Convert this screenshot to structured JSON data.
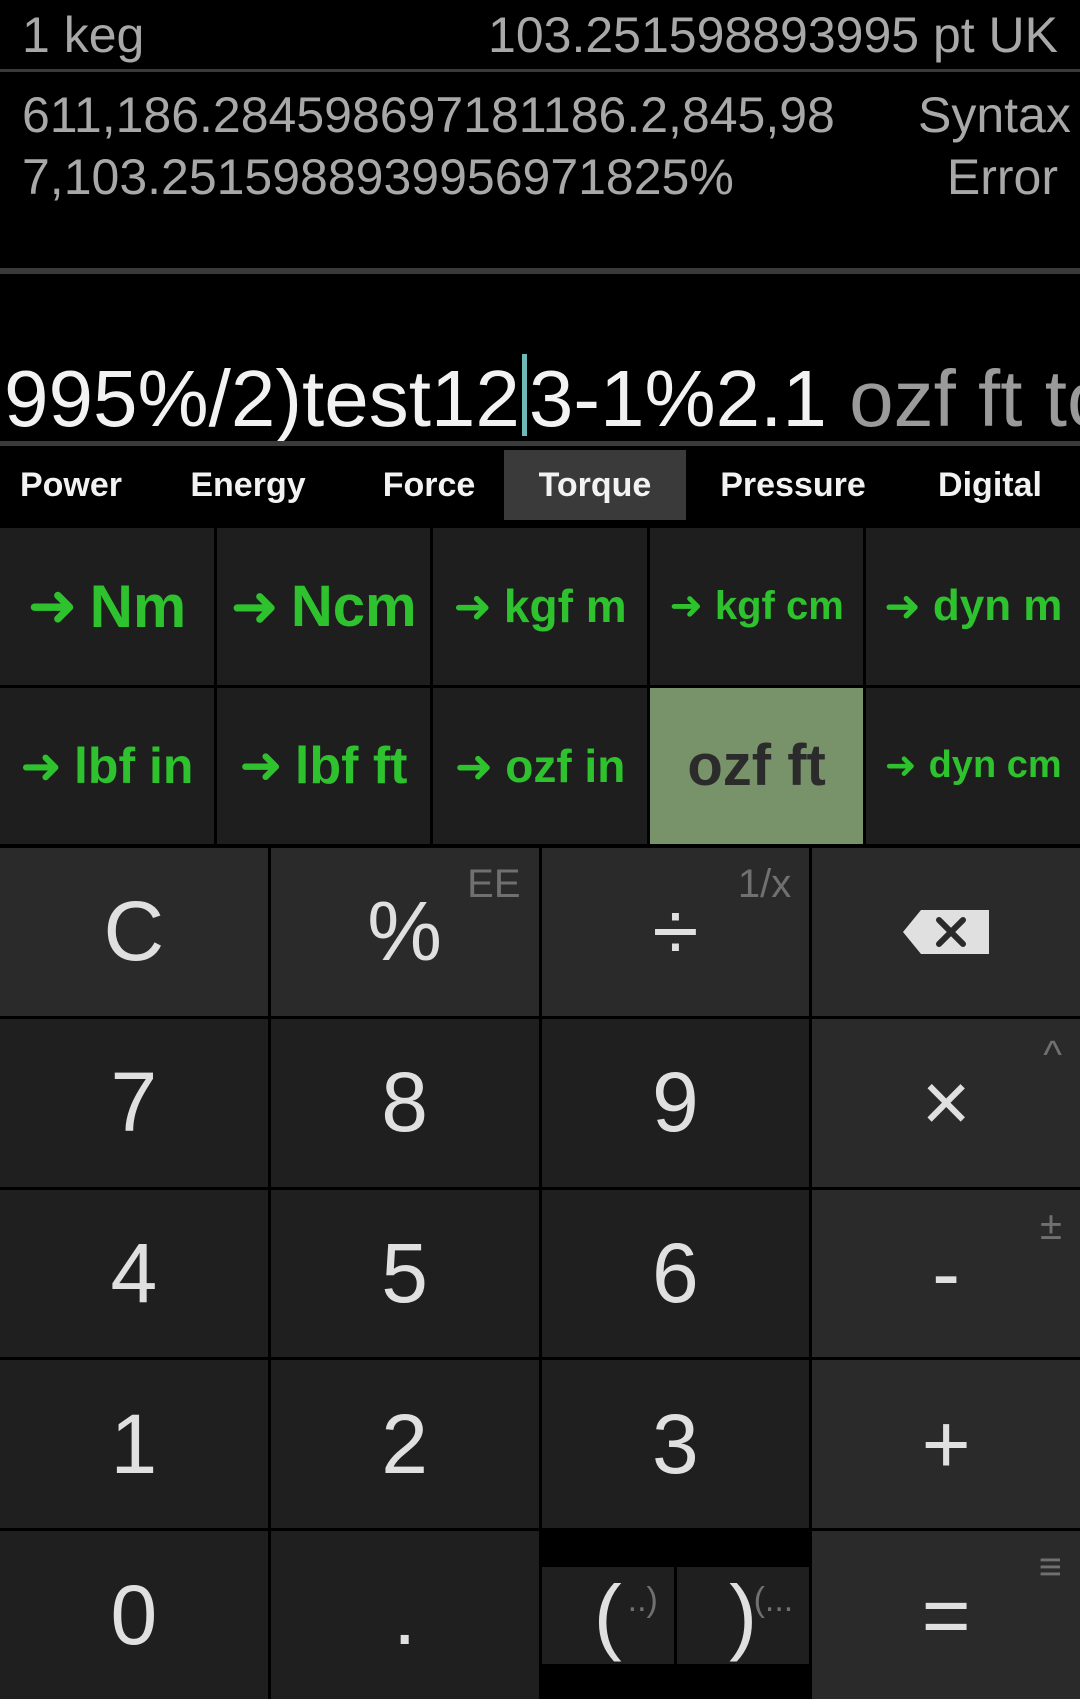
{
  "history": {
    "input": "1 keg",
    "result": "103.251598893995 pt UK",
    "expression": "611,186.284598697181186.2,845,987,103.2515988939956971825%",
    "error": "Syntax Error"
  },
  "input": {
    "text": "995%/2)test12",
    "after_cursor": "3-1%2.1",
    "suffix": " ozf ft to:"
  },
  "tabs": [
    {
      "label": "Power",
      "active": false
    },
    {
      "label": "Energy",
      "active": false
    },
    {
      "label": "Force",
      "active": false
    },
    {
      "label": "Torque",
      "active": true
    },
    {
      "label": "Pressure",
      "active": false
    },
    {
      "label": "Digital",
      "active": false
    }
  ],
  "units": [
    {
      "label": "Nm",
      "arrow": "➜",
      "active": false
    },
    {
      "label": "Ncm",
      "arrow": "➜",
      "active": false
    },
    {
      "label": "kgf m",
      "arrow": "➜",
      "active": false
    },
    {
      "label": "kgf cm",
      "arrow": "➜",
      "active": false
    },
    {
      "label": "dyn m",
      "arrow": "➜",
      "active": false
    },
    {
      "label": "lbf in",
      "arrow": "➜",
      "active": false
    },
    {
      "label": "lbf ft",
      "arrow": "➜",
      "active": false
    },
    {
      "label": "ozf in",
      "arrow": "➜",
      "active": false
    },
    {
      "label": "ozf ft",
      "arrow": "",
      "active": true
    },
    {
      "label": "dyn cm",
      "arrow": "➜",
      "active": false
    }
  ],
  "keys": {
    "clear": "C",
    "percent": "%",
    "percent_sub": "EE",
    "divide": "÷",
    "divide_sub": "1/x",
    "backspace_icon": "backspace-icon",
    "seven": "7",
    "eight": "8",
    "nine": "9",
    "multiply": "×",
    "multiply_sub": "^",
    "four": "4",
    "five": "5",
    "six": "6",
    "minus": "-",
    "minus_sub": "±",
    "one": "1",
    "two": "2",
    "three": "3",
    "plus": "+",
    "zero": "0",
    "dot": ".",
    "open_paren": "(",
    "open_paren_sub": "..)",
    "close_paren": ")",
    "close_paren_sub": "(...",
    "equals": "=",
    "equals_sub": "≡"
  },
  "colors": {
    "accent_green": "#2fc22f",
    "active_unit_bg": "#78926a",
    "cursor": "#6fb8b8"
  }
}
